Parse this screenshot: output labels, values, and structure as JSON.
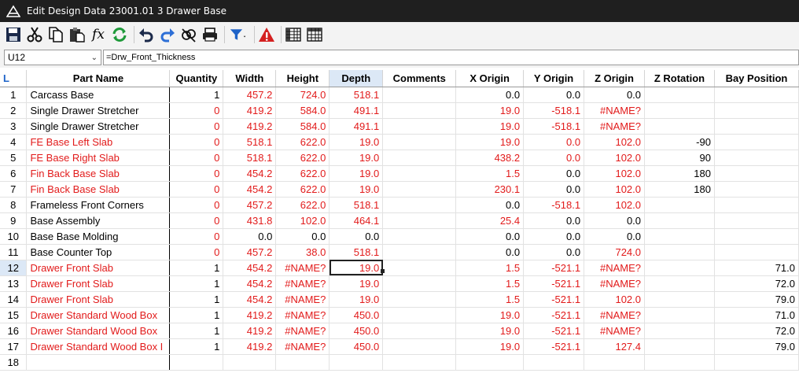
{
  "window": {
    "title": "Edit Design Data 23001.01 3 Drawer Base"
  },
  "toolbar": {
    "buttons": [
      {
        "name": "save-icon"
      },
      {
        "name": "cut-icon"
      },
      {
        "name": "copy-icon"
      },
      {
        "name": "paste-icon"
      },
      {
        "name": "function-icon",
        "label": "fx"
      },
      {
        "name": "refresh-icon"
      },
      {
        "name": "undo-icon"
      },
      {
        "name": "redo-icon"
      },
      {
        "name": "link-icon"
      },
      {
        "name": "printer-icon"
      },
      {
        "name": "filter-icon"
      },
      {
        "name": "warning-icon"
      },
      {
        "name": "grid-view-icon"
      },
      {
        "name": "table-view-icon"
      }
    ],
    "fx_label": "fx"
  },
  "formula_bar": {
    "cell_ref": "U12",
    "formula": "=Drw_Front_Thickness"
  },
  "grid": {
    "corner_label": "L",
    "columns": [
      "Part Name",
      "Quantity",
      "Width",
      "Height",
      "Depth",
      "Comments",
      "X Origin",
      "Y Origin",
      "Z Origin",
      "Z Rotation",
      "Bay Position"
    ],
    "active_column": "Depth",
    "active_row": 12,
    "rows": [
      {
        "n": "1",
        "name": "Carcass Base",
        "red": false,
        "cells": [
          [
            "1",
            false
          ],
          [
            "457.2",
            true
          ],
          [
            "724.0",
            true
          ],
          [
            "518.1",
            true
          ],
          [
            "",
            false
          ],
          [
            "0.0",
            false
          ],
          [
            "0.0",
            false
          ],
          [
            "0.0",
            false
          ],
          [
            "",
            false
          ],
          [
            "",
            false
          ]
        ]
      },
      {
        "n": "2",
        "name": "Single Drawer Stretcher",
        "red": false,
        "cells": [
          [
            "0",
            true
          ],
          [
            "419.2",
            true
          ],
          [
            "584.0",
            true
          ],
          [
            "491.1",
            true
          ],
          [
            "",
            false
          ],
          [
            "19.0",
            true
          ],
          [
            "-518.1",
            true
          ],
          [
            "#NAME?",
            true
          ],
          [
            "",
            false
          ],
          [
            "",
            false
          ]
        ]
      },
      {
        "n": "3",
        "name": "Single Drawer Stretcher",
        "red": false,
        "cells": [
          [
            "0",
            true
          ],
          [
            "419.2",
            true
          ],
          [
            "584.0",
            true
          ],
          [
            "491.1",
            true
          ],
          [
            "",
            false
          ],
          [
            "19.0",
            true
          ],
          [
            "-518.1",
            true
          ],
          [
            "#NAME?",
            true
          ],
          [
            "",
            false
          ],
          [
            "",
            false
          ]
        ]
      },
      {
        "n": "4",
        "name": "FE Base Left Slab",
        "red": true,
        "cells": [
          [
            "0",
            true
          ],
          [
            "518.1",
            true
          ],
          [
            "622.0",
            true
          ],
          [
            "19.0",
            true
          ],
          [
            "",
            false
          ],
          [
            "19.0",
            true
          ],
          [
            "0.0",
            true
          ],
          [
            "102.0",
            true
          ],
          [
            "-90",
            false
          ],
          [
            "",
            false
          ]
        ]
      },
      {
        "n": "5",
        "name": "FE Base Right Slab",
        "red": true,
        "cells": [
          [
            "0",
            true
          ],
          [
            "518.1",
            true
          ],
          [
            "622.0",
            true
          ],
          [
            "19.0",
            true
          ],
          [
            "",
            false
          ],
          [
            "438.2",
            true
          ],
          [
            "0.0",
            true
          ],
          [
            "102.0",
            true
          ],
          [
            "90",
            false
          ],
          [
            "",
            false
          ]
        ]
      },
      {
        "n": "6",
        "name": "Fin Back Base Slab",
        "red": true,
        "cells": [
          [
            "0",
            true
          ],
          [
            "454.2",
            true
          ],
          [
            "622.0",
            true
          ],
          [
            "19.0",
            true
          ],
          [
            "",
            false
          ],
          [
            "1.5",
            true
          ],
          [
            "0.0",
            false
          ],
          [
            "102.0",
            true
          ],
          [
            "180",
            false
          ],
          [
            "",
            false
          ]
        ]
      },
      {
        "n": "7",
        "name": "Fin Back Base Slab",
        "red": true,
        "cells": [
          [
            "0",
            true
          ],
          [
            "454.2",
            true
          ],
          [
            "622.0",
            true
          ],
          [
            "19.0",
            true
          ],
          [
            "",
            false
          ],
          [
            "230.1",
            true
          ],
          [
            "0.0",
            false
          ],
          [
            "102.0",
            true
          ],
          [
            "180",
            false
          ],
          [
            "",
            false
          ]
        ]
      },
      {
        "n": "8",
        "name": "Frameless Front Corners",
        "red": false,
        "cells": [
          [
            "0",
            true
          ],
          [
            "457.2",
            true
          ],
          [
            "622.0",
            true
          ],
          [
            "518.1",
            true
          ],
          [
            "",
            false
          ],
          [
            "0.0",
            false
          ],
          [
            "-518.1",
            true
          ],
          [
            "102.0",
            true
          ],
          [
            "",
            false
          ],
          [
            "",
            false
          ]
        ]
      },
      {
        "n": "9",
        "name": "Base Assembly",
        "red": false,
        "cells": [
          [
            "0",
            true
          ],
          [
            "431.8",
            true
          ],
          [
            "102.0",
            true
          ],
          [
            "464.1",
            true
          ],
          [
            "",
            false
          ],
          [
            "25.4",
            true
          ],
          [
            "0.0",
            false
          ],
          [
            "0.0",
            false
          ],
          [
            "",
            false
          ],
          [
            "",
            false
          ]
        ]
      },
      {
        "n": "10",
        "name": "Base Base Molding",
        "red": false,
        "cells": [
          [
            "0",
            true
          ],
          [
            "0.0",
            false
          ],
          [
            "0.0",
            false
          ],
          [
            "0.0",
            false
          ],
          [
            "",
            false
          ],
          [
            "0.0",
            false
          ],
          [
            "0.0",
            false
          ],
          [
            "0.0",
            false
          ],
          [
            "",
            false
          ],
          [
            "",
            false
          ]
        ]
      },
      {
        "n": "11",
        "name": "Base Counter Top",
        "red": false,
        "cells": [
          [
            "0",
            true
          ],
          [
            "457.2",
            true
          ],
          [
            "38.0",
            true
          ],
          [
            "518.1",
            true
          ],
          [
            "",
            false
          ],
          [
            "0.0",
            false
          ],
          [
            "0.0",
            false
          ],
          [
            "724.0",
            true
          ],
          [
            "",
            false
          ],
          [
            "",
            false
          ]
        ]
      },
      {
        "n": "12",
        "name": "Drawer Front Slab",
        "red": true,
        "cells": [
          [
            "1",
            false
          ],
          [
            "454.2",
            true
          ],
          [
            "#NAME?",
            true
          ],
          [
            "19.0",
            true
          ],
          [
            "",
            false
          ],
          [
            "1.5",
            true
          ],
          [
            "-521.1",
            true
          ],
          [
            "#NAME?",
            true
          ],
          [
            "",
            false
          ],
          [
            "71.0",
            false
          ]
        ]
      },
      {
        "n": "13",
        "name": "Drawer Front Slab",
        "red": true,
        "cells": [
          [
            "1",
            false
          ],
          [
            "454.2",
            true
          ],
          [
            "#NAME?",
            true
          ],
          [
            "19.0",
            true
          ],
          [
            "",
            false
          ],
          [
            "1.5",
            true
          ],
          [
            "-521.1",
            true
          ],
          [
            "#NAME?",
            true
          ],
          [
            "",
            false
          ],
          [
            "72.0",
            false
          ]
        ]
      },
      {
        "n": "14",
        "name": "Drawer Front Slab",
        "red": true,
        "cells": [
          [
            "1",
            false
          ],
          [
            "454.2",
            true
          ],
          [
            "#NAME?",
            true
          ],
          [
            "19.0",
            true
          ],
          [
            "",
            false
          ],
          [
            "1.5",
            true
          ],
          [
            "-521.1",
            true
          ],
          [
            "102.0",
            true
          ],
          [
            "",
            false
          ],
          [
            "79.0",
            false
          ]
        ]
      },
      {
        "n": "15",
        "name": "Drawer Standard Wood Box",
        "red": true,
        "cells": [
          [
            "1",
            false
          ],
          [
            "419.2",
            true
          ],
          [
            "#NAME?",
            true
          ],
          [
            "450.0",
            true
          ],
          [
            "",
            false
          ],
          [
            "19.0",
            true
          ],
          [
            "-521.1",
            true
          ],
          [
            "#NAME?",
            true
          ],
          [
            "",
            false
          ],
          [
            "71.0",
            false
          ]
        ]
      },
      {
        "n": "16",
        "name": "Drawer Standard Wood Box",
        "red": true,
        "cells": [
          [
            "1",
            false
          ],
          [
            "419.2",
            true
          ],
          [
            "#NAME?",
            true
          ],
          [
            "450.0",
            true
          ],
          [
            "",
            false
          ],
          [
            "19.0",
            true
          ],
          [
            "-521.1",
            true
          ],
          [
            "#NAME?",
            true
          ],
          [
            "",
            false
          ],
          [
            "72.0",
            false
          ]
        ]
      },
      {
        "n": "17",
        "name": "Drawer Standard Wood Box I",
        "red": true,
        "cells": [
          [
            "1",
            false
          ],
          [
            "419.2",
            true
          ],
          [
            "#NAME?",
            true
          ],
          [
            "450.0",
            true
          ],
          [
            "",
            false
          ],
          [
            "19.0",
            true
          ],
          [
            "-521.1",
            true
          ],
          [
            "127.4",
            true
          ],
          [
            "",
            false
          ],
          [
            "79.0",
            false
          ]
        ]
      },
      {
        "n": "18",
        "name": "",
        "red": false,
        "cells": [
          [
            "",
            false
          ],
          [
            "",
            false
          ],
          [
            "",
            false
          ],
          [
            "",
            false
          ],
          [
            "",
            false
          ],
          [
            "",
            false
          ],
          [
            "",
            false
          ],
          [
            "",
            false
          ],
          [
            "",
            false
          ],
          [
            "",
            false
          ]
        ]
      }
    ]
  },
  "colors": {
    "error_text": "#e21b1b",
    "header_active": "#dce8f6",
    "titlebar": "#1f1f1f"
  }
}
